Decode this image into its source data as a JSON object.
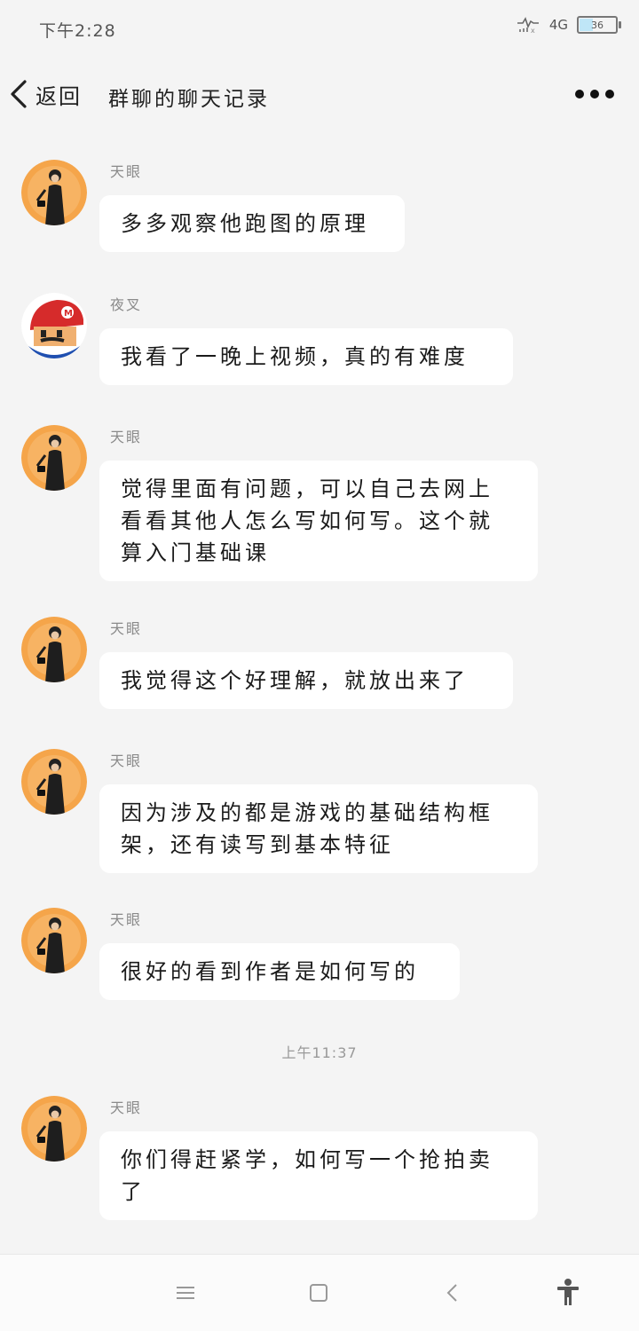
{
  "status_bar": {
    "time": "下午2:28",
    "network": "4G",
    "battery_level": "36"
  },
  "nav": {
    "back_label": "返回",
    "title": "群聊的聊天记录"
  },
  "messages": [
    {
      "sender": "天眼",
      "avatar": "woman-black-dress-avatar",
      "text": "多多观察他跑图的原理"
    },
    {
      "sender": "夜叉",
      "avatar": "mario-avatar",
      "text": "我看了一晚上视频，真的有难度"
    },
    {
      "sender": "天眼",
      "avatar": "woman-black-dress-avatar",
      "text": "觉得里面有问题，可以自己去网上看看其他人怎么写如何写。这个就算入门基础课"
    },
    {
      "sender": "天眼",
      "avatar": "woman-black-dress-avatar",
      "text": "我觉得这个好理解，就放出来了"
    },
    {
      "sender": "天眼",
      "avatar": "woman-black-dress-avatar",
      "text": "因为涉及的都是游戏的基础结构框架，还有读写到基本特征"
    },
    {
      "sender": "天眼",
      "avatar": "woman-black-dress-avatar",
      "text": "很好的看到作者是如何写的"
    },
    {
      "sender": "天眼",
      "avatar": "woman-black-dress-avatar",
      "text": "你们得赶紧学，如何写一个抢拍卖了"
    }
  ],
  "time_divider": "上午11:37",
  "system_nav": {
    "icons": [
      "menu-icon",
      "home-square-icon",
      "back-chevron-icon",
      "accessibility-icon"
    ]
  },
  "colors": {
    "background": "#f4f4f4",
    "bubble": "#ffffff",
    "avatar_orange": "#f5a54a"
  }
}
